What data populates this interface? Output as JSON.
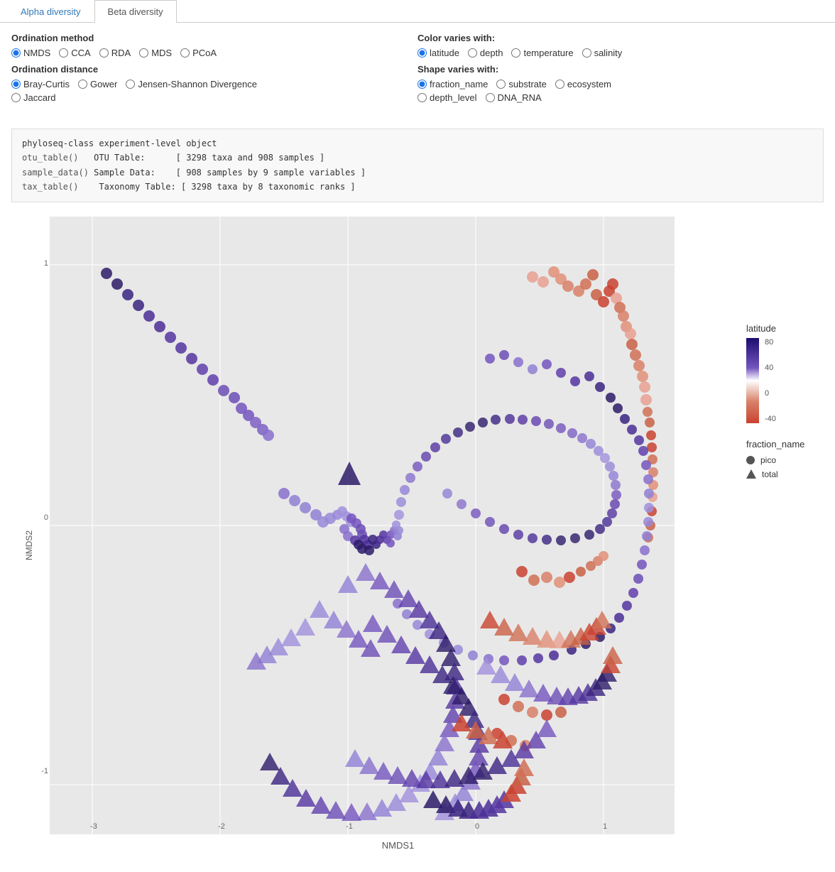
{
  "tabs": [
    {
      "label": "Alpha diversity",
      "active": false
    },
    {
      "label": "Beta diversity",
      "active": true
    }
  ],
  "ordination_method": {
    "label": "Ordination method",
    "options": [
      "NMDS",
      "CCA",
      "RDA",
      "MDS",
      "PCoA"
    ],
    "selected": "NMDS"
  },
  "ordination_distance": {
    "label": "Ordination distance",
    "options": [
      "Bray-Curtis",
      "Gower",
      "Jensen-Shannon Divergence",
      "Jaccard"
    ],
    "selected": "Bray-Curtis"
  },
  "color_varies": {
    "label": "Color varies with:",
    "options": [
      "latitude",
      "depth",
      "temperature",
      "salinity"
    ],
    "selected": "latitude"
  },
  "shape_varies": {
    "label": "Shape varies with:",
    "options": [
      "fraction_name",
      "substrate",
      "ecosystem",
      "depth_level",
      "DNA_RNA"
    ],
    "selected": "fraction_name"
  },
  "info_box": {
    "line1": "phyloseq-class experiment-level object",
    "line2_label": "otu_table()",
    "line2_name": "OTU Table:",
    "line2_value": "[ 3298 taxa and 908 samples ]",
    "line3_label": "sample_data()",
    "line3_name": "Sample Data:",
    "line3_value": "[ 908 samples by 9 sample variables ]",
    "line4_label": "tax_table()",
    "line4_name": "Taxonomy Table:",
    "line4_value": "[ 3298 taxa by 8 taxonomic ranks ]"
  },
  "chart": {
    "x_label": "NMDS1",
    "y_label": "NMDS2",
    "x_ticks": [
      "-3",
      "-2",
      "-1",
      "0",
      "1"
    ],
    "y_ticks": [
      "1",
      "0",
      "-1"
    ],
    "legend_title": "latitude",
    "legend_values": [
      "80",
      "40",
      "0",
      "-40"
    ],
    "legend_colors": [
      "#1a0c6e",
      "#5b3ea6",
      "#ffffff",
      "#c94230"
    ],
    "shape_legend_title": "fraction_name",
    "shape_items": [
      "pico",
      "total"
    ]
  }
}
